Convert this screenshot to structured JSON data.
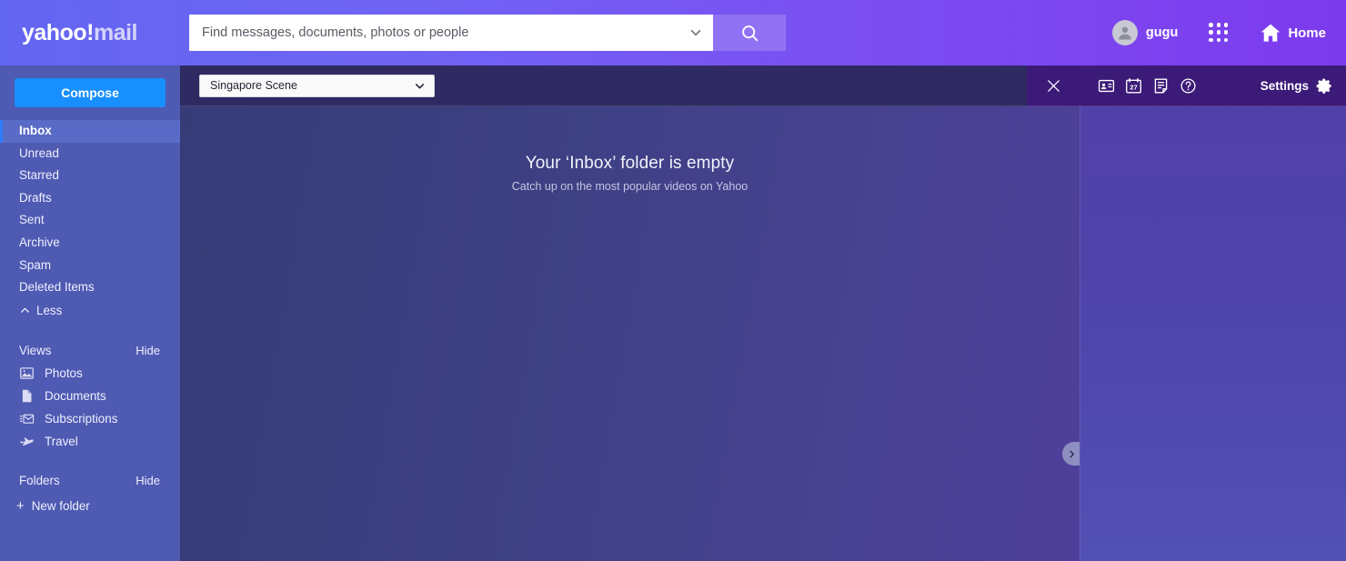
{
  "header": {
    "logo": {
      "brand": "yahoo",
      "bang": "!",
      "suffix": "mail"
    },
    "search": {
      "placeholder": "Find messages, documents, photos or people",
      "value": "",
      "expand_icon": "chevron-down-icon",
      "search_icon": "search-icon"
    },
    "account": {
      "name": "gugu",
      "avatar_icon": "person-avatar-icon"
    },
    "apps_icon": "apps-grid-icon",
    "home": {
      "label": "Home",
      "icon": "home-icon"
    },
    "gradient_from": "#6366f1",
    "gradient_to": "#7c3aed"
  },
  "sidebar": {
    "compose_label": "Compose",
    "folders": [
      {
        "label": "Inbox",
        "active": true
      },
      {
        "label": "Unread",
        "active": false
      },
      {
        "label": "Starred",
        "active": false
      },
      {
        "label": "Drafts",
        "active": false
      },
      {
        "label": "Sent",
        "active": false
      },
      {
        "label": "Archive",
        "active": false
      },
      {
        "label": "Spam",
        "active": false
      },
      {
        "label": "Deleted Items",
        "active": false
      }
    ],
    "less_label": "Less",
    "views": {
      "title": "Views",
      "hide_label": "Hide",
      "items": [
        {
          "label": "Photos",
          "icon": "photos-icon"
        },
        {
          "label": "Documents",
          "icon": "document-icon"
        },
        {
          "label": "Subscriptions",
          "icon": "subscriptions-envelope-icon"
        },
        {
          "label": "Travel",
          "icon": "airplane-icon"
        }
      ]
    },
    "folders_section": {
      "title": "Folders",
      "hide_label": "Hide",
      "new_folder_label": "New folder"
    },
    "bg_color": "#4f5ab2",
    "compose_color": "#188fff",
    "active_color": "#5a6bc7",
    "active_accent": "#2d7dff"
  },
  "center": {
    "scene_select": {
      "value": "Singapore Scene",
      "chevron_icon": "chevron-down-icon"
    },
    "close_icon": "close-icon",
    "empty_state": {
      "title": "Your ‘Inbox’ folder is empty",
      "subtitle": "Catch up on the most popular videos on Yahoo"
    },
    "expand_tab_icon": "chevron-right-icon"
  },
  "right_panel": {
    "toolbar_icons": [
      {
        "name": "contacts-card-icon"
      },
      {
        "name": "calendar-icon",
        "badge": "27"
      },
      {
        "name": "notepad-icon"
      },
      {
        "name": "help-question-icon"
      }
    ],
    "settings": {
      "label": "Settings",
      "icon": "gear-icon"
    },
    "toolbar_bg": "#3c1a78"
  }
}
